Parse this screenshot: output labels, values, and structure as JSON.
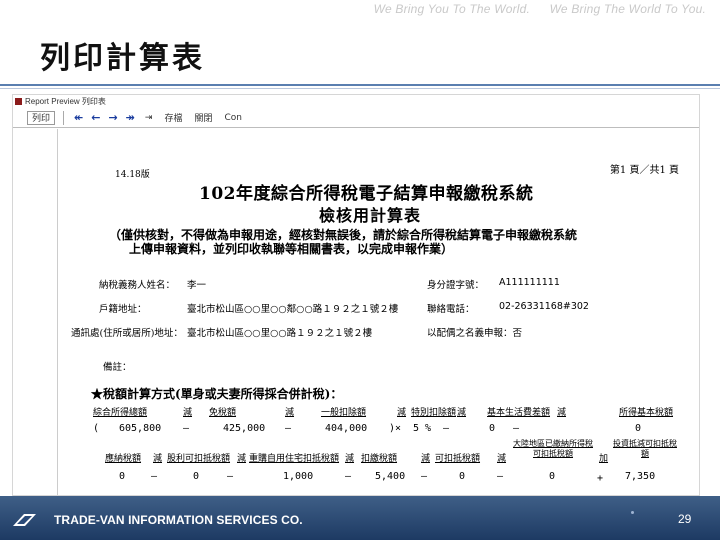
{
  "slide": {
    "tagline": [
      "We Bring You To The World.",
      "We Bring The World To You."
    ],
    "title": "列印計算表",
    "footer_company": "TRADE-VAN INFORMATION SERVICES CO.",
    "page_number": "29"
  },
  "window": {
    "title": "Report Preview 列印表",
    "toolbar": [
      "列印",
      "↞",
      "←",
      "→",
      "↠",
      "⇥",
      "存檔",
      "關閉",
      "Con"
    ]
  },
  "report": {
    "version": "14.18版",
    "page_info": "第1 頁／共1 頁",
    "heading": "102年度綜合所得稅電子結算申報繳稅系統",
    "subheading": "檢核用計算表",
    "notice_line1": "（僅供核對，不得做為申報用途，經核對無誤後，請於綜合所得稅結算電子申報繳稅系統",
    "notice_line2": "上傳申報資料，並列印收執聯等相關書表，以完成申報作業）",
    "fields": {
      "taxpayer_name_label": "納稅義務人姓名：",
      "taxpayer_name": "李一",
      "id_label": "身分證字號：",
      "id": "A111111111",
      "household_label": "戶籍地址：",
      "household": "臺北市松山區○○里○○鄰○○路１９２之１號２樓",
      "phone_label": "聯絡電話：",
      "phone": "02-26331168#302",
      "mail_label": "通訊處(住所或居所)地址：",
      "mail": "臺北市松山區○○里○○路１９２之１號２樓",
      "spouse_label": "以配偶之名義申報：否",
      "remark_label": "備註："
    },
    "section_title": "★稅額計算方式(單身或夫妻所得採合併計稅)：",
    "row1": {
      "headers": [
        "綜合所得總額",
        "減",
        "免稅額",
        "減",
        "一般扣除額",
        "減",
        "特別扣除額",
        "減",
        "基本生活費差額",
        "減",
        "所得基本稅額"
      ],
      "values": [
        "605,800",
        "425,000",
        "404,000",
        "5",
        "0",
        "0"
      ],
      "ops": [
        "(",
        "—",
        "—",
        "—",
        ")×",
        "%",
        "—",
        "—"
      ]
    },
    "row2": {
      "headers": [
        "應納稅額",
        "減",
        "股利可扣抵稅額",
        "減",
        "重購自用住宅扣抵稅額",
        "減",
        "扣繳稅額",
        "減",
        "可扣抵稅額",
        "減",
        "大陸地區已繳納所得稅可扣抵稅額",
        "加",
        "投資抵減可扣抵稅額"
      ],
      "values": [
        "0",
        "0",
        "1,000",
        "5,400",
        "0",
        "0",
        "7,350"
      ],
      "ops": [
        "—",
        "—",
        "—",
        "—",
        "—",
        "+"
      ]
    }
  }
}
